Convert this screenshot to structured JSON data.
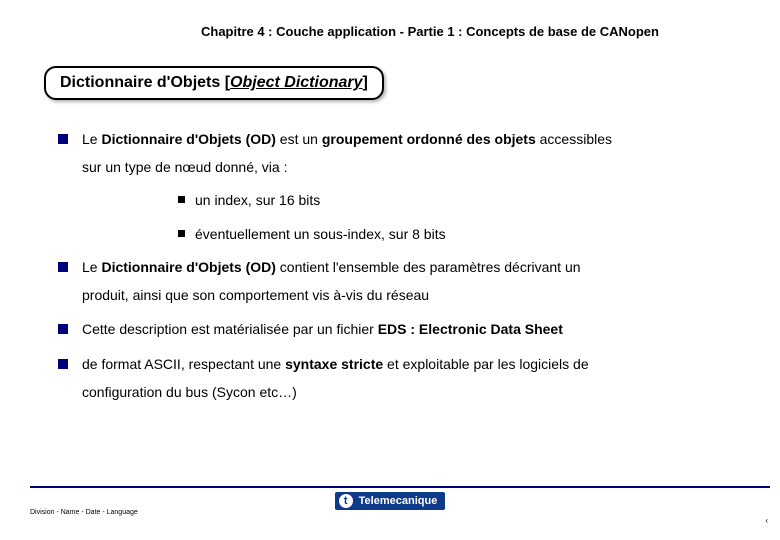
{
  "header": {
    "chapter": "Chapitre 4 : Couche application - Partie 1 : Concepts de base de CANopen"
  },
  "title": {
    "main": "Dictionnaire d'Objets [",
    "italic": "Object Dictionary",
    "close": "]"
  },
  "bullets": {
    "b1_pre": "Le ",
    "b1_bold": "Dictionnaire d'Objets (OD)",
    "b1_mid": " est un ",
    "b1_bold2": "groupement ordonné des objets",
    "b1_post": " accessibles",
    "b1_line2": "sur un type de nœud donné, via :",
    "sub1": "un index, sur 16 bits",
    "sub2": "éventuellement un sous-index, sur 8 bits",
    "b2_pre": "Le ",
    "b2_bold": "Dictionnaire d'Objets (OD)",
    "b2_post": " contient l'ensemble des paramètres décrivant un",
    "b2_line2": "produit, ainsi que son comportement vis à-vis du réseau",
    "b3_pre": "Cette description est matérialisée par un fichier ",
    "b3_bold": "EDS : Electronic Data Sheet",
    "b4_pre": " de format ASCII, respectant une ",
    "b4_bold": "syntaxe stricte",
    "b4_post": " et exploitable par les logiciels de",
    "b4_line2": "configuration du bus (Sycon etc…)"
  },
  "footer": {
    "meta": "Division - Name - Date - Language",
    "brand": "Telemecanique",
    "pagecorner": "‹"
  }
}
